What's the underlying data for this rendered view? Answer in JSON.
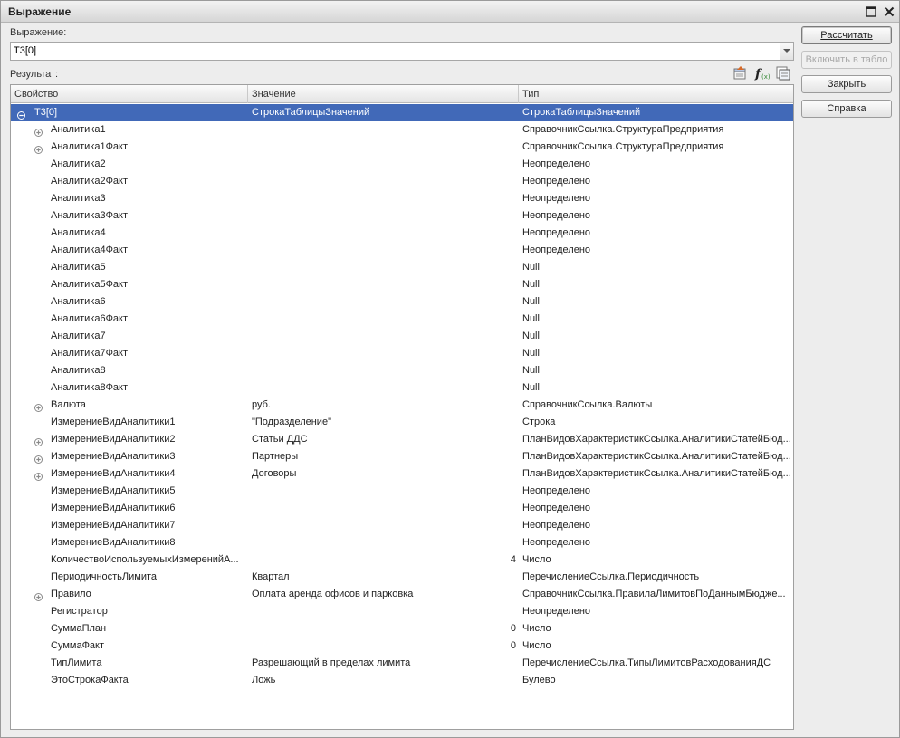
{
  "window": {
    "title": "Выражение"
  },
  "expression": {
    "label": "Выражение:",
    "value": "Т3[0]"
  },
  "result": {
    "label": "Результат:"
  },
  "grid": {
    "columns": [
      "Свойство",
      "Значение",
      "Тип"
    ],
    "rows": [
      {
        "prop": "Т3[0]",
        "value": "СтрокаТаблицыЗначений",
        "type": "СтрокаТаблицыЗначений",
        "level": 0,
        "expander": "collapse",
        "selected": true
      },
      {
        "prop": "Аналитика1",
        "value": "",
        "type": "СправочникСсылка.СтруктураПредприятия",
        "level": 1,
        "expander": "expand"
      },
      {
        "prop": "Аналитика1Факт",
        "value": "",
        "type": "СправочникСсылка.СтруктураПредприятия",
        "level": 1,
        "expander": "expand"
      },
      {
        "prop": "Аналитика2",
        "value": "",
        "type": "Неопределено",
        "level": 1
      },
      {
        "prop": "Аналитика2Факт",
        "value": "",
        "type": "Неопределено",
        "level": 1
      },
      {
        "prop": "Аналитика3",
        "value": "",
        "type": "Неопределено",
        "level": 1
      },
      {
        "prop": "Аналитика3Факт",
        "value": "",
        "type": "Неопределено",
        "level": 1
      },
      {
        "prop": "Аналитика4",
        "value": "",
        "type": "Неопределено",
        "level": 1
      },
      {
        "prop": "Аналитика4Факт",
        "value": "",
        "type": "Неопределено",
        "level": 1
      },
      {
        "prop": "Аналитика5",
        "value": "",
        "type": "Null",
        "level": 1
      },
      {
        "prop": "Аналитика5Факт",
        "value": "",
        "type": "Null",
        "level": 1
      },
      {
        "prop": "Аналитика6",
        "value": "",
        "type": "Null",
        "level": 1
      },
      {
        "prop": "Аналитика6Факт",
        "value": "",
        "type": "Null",
        "level": 1
      },
      {
        "prop": "Аналитика7",
        "value": "",
        "type": "Null",
        "level": 1
      },
      {
        "prop": "Аналитика7Факт",
        "value": "",
        "type": "Null",
        "level": 1
      },
      {
        "prop": "Аналитика8",
        "value": "",
        "type": "Null",
        "level": 1
      },
      {
        "prop": "Аналитика8Факт",
        "value": "",
        "type": "Null",
        "level": 1
      },
      {
        "prop": "Валюта",
        "value": "руб.",
        "type": "СправочникСсылка.Валюты",
        "level": 1,
        "expander": "expand"
      },
      {
        "prop": "ИзмерениеВидАналитики1",
        "value": "\"Подразделение\"",
        "type": "Строка",
        "level": 1
      },
      {
        "prop": "ИзмерениеВидАналитики2",
        "value": "Статьи ДДС",
        "type": "ПланВидовХарактеристикСсылка.АналитикиСтатейБюд...",
        "level": 1,
        "expander": "expand"
      },
      {
        "prop": "ИзмерениеВидАналитики3",
        "value": "Партнеры",
        "type": "ПланВидовХарактеристикСсылка.АналитикиСтатейБюд...",
        "level": 1,
        "expander": "expand"
      },
      {
        "prop": "ИзмерениеВидАналитики4",
        "value": "Договоры",
        "type": "ПланВидовХарактеристикСсылка.АналитикиСтатейБюд...",
        "level": 1,
        "expander": "expand"
      },
      {
        "prop": "ИзмерениеВидАналитики5",
        "value": "",
        "type": "Неопределено",
        "level": 1
      },
      {
        "prop": "ИзмерениеВидАналитики6",
        "value": "",
        "type": "Неопределено",
        "level": 1
      },
      {
        "prop": "ИзмерениеВидАналитики7",
        "value": "",
        "type": "Неопределено",
        "level": 1
      },
      {
        "prop": "ИзмерениеВидАналитики8",
        "value": "",
        "type": "Неопределено",
        "level": 1
      },
      {
        "prop": "КоличествоИспользуемыхИзмеренийА...",
        "value": "4",
        "type": "Число",
        "level": 1,
        "numeric": true
      },
      {
        "prop": "ПериодичностьЛимита",
        "value": "Квартал",
        "type": "ПеречислениеСсылка.Периодичность",
        "level": 1
      },
      {
        "prop": "Правило",
        "value": "Оплата аренда офисов и парковка",
        "type": "СправочникСсылка.ПравилаЛимитовПоДаннымБюдже...",
        "level": 1,
        "expander": "expand"
      },
      {
        "prop": "Регистратор",
        "value": "",
        "type": "Неопределено",
        "level": 1
      },
      {
        "prop": "СуммаПлан",
        "value": "0",
        "type": "Число",
        "level": 1,
        "numeric": true
      },
      {
        "prop": "СуммаФакт",
        "value": "0",
        "type": "Число",
        "level": 1,
        "numeric": true
      },
      {
        "prop": "ТипЛимита",
        "value": "Разрешающий в пределах лимита",
        "type": "ПеречислениеСсылка.ТипыЛимитовРасходованияДС",
        "level": 1
      },
      {
        "prop": "ЭтоСтрокаФакта",
        "value": "Ложь",
        "type": "Булево",
        "level": 1
      }
    ]
  },
  "buttons": {
    "calculate": "Рассчитать",
    "include": "Включить в табло",
    "close": "Закрыть",
    "help": "Справка"
  },
  "icons": {
    "maximize": "maximize-icon",
    "close": "close-icon",
    "result_tools": [
      "expand-properties-icon",
      "function-icon",
      "table-view-icon"
    ]
  },
  "colors": {
    "selection": "#4169b8",
    "window_bg": "#ededed"
  }
}
